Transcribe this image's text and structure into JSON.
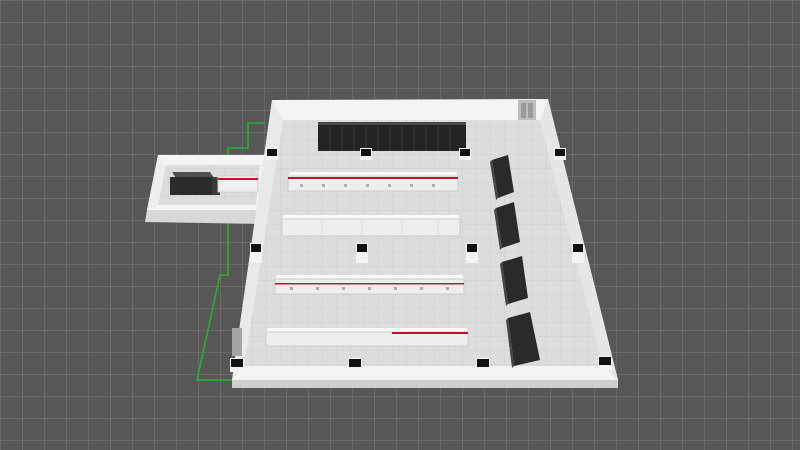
{
  "scene": {
    "colors": {
      "background": "#575757",
      "grid_line": "#7a7a7a",
      "floor": "#dcdcdc",
      "floor_tile": "#c9c9c9",
      "wall_top": "#f4f4f4",
      "wall_face": "#d6d6d6",
      "boundary_line": "#1fb82a",
      "rack_body": "#f2f2f2",
      "rack_stripe": "#c8102e",
      "dark_cabinet": "#2b2b2b",
      "pillar_cap": "#111111"
    },
    "objects": {
      "room": "data-center-room",
      "annex": "side-annex-room",
      "door": "door-icon",
      "rack_rows": [
        "rack-row-1",
        "rack-row-2",
        "rack-row-3",
        "rack-row-4"
      ],
      "cabinets": [
        "ups-cabinet-1",
        "ups-cabinet-2",
        "ups-cabinet-3",
        "ups-cabinet-4"
      ],
      "black_server_bank": "server-bank-icon",
      "annex_equipment": "annex-equipment-icon"
    }
  }
}
